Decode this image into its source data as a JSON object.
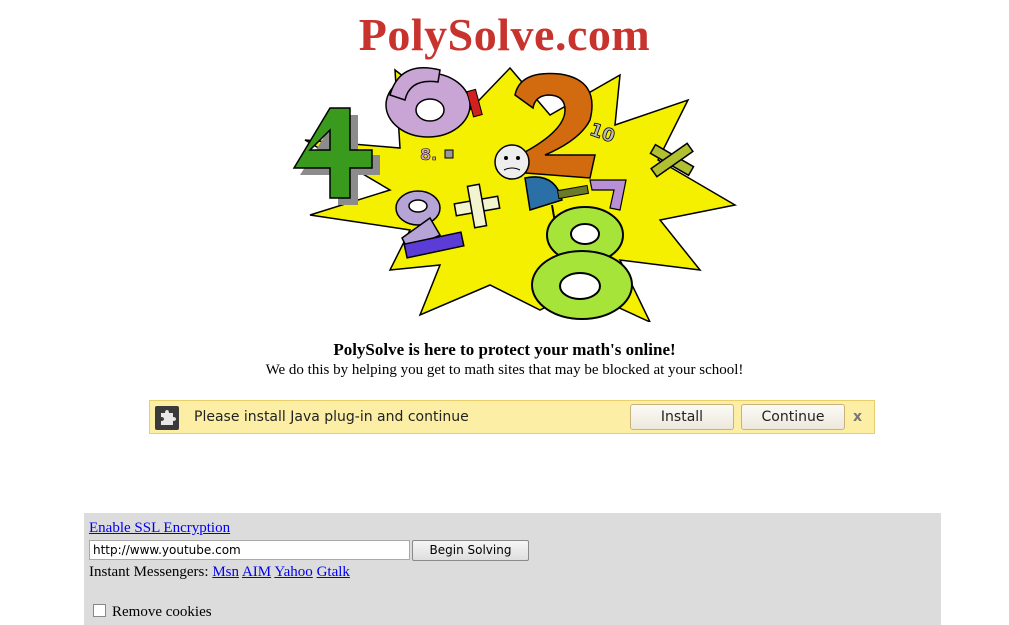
{
  "header": {
    "title": "PolySolve.com"
  },
  "hero": {
    "image": "math-numbers-clipart"
  },
  "intro": {
    "tagline": "PolySolve is here to protect your math's online!",
    "subline": "We do this by helping you get to math sites that may be blocked at your school!"
  },
  "infobar": {
    "icon": "puzzle-piece-icon",
    "message": "Please install Java plug-in and continue",
    "install_label": "Install",
    "continue_label": "Continue",
    "close_label": "x",
    "background": "#fcefa5"
  },
  "proxy": {
    "ssl_link": "Enable SSL Encryption",
    "url_value": "http://www.youtube.com",
    "submit_label": "Begin Solving",
    "messengers_label": "Instant Messengers:",
    "messengers": [
      "Msn",
      "AIM",
      "Yahoo",
      "Gtalk"
    ],
    "cookies_label": "Remove cookies",
    "cookies_checked": false,
    "background": "#dcdcdc"
  }
}
